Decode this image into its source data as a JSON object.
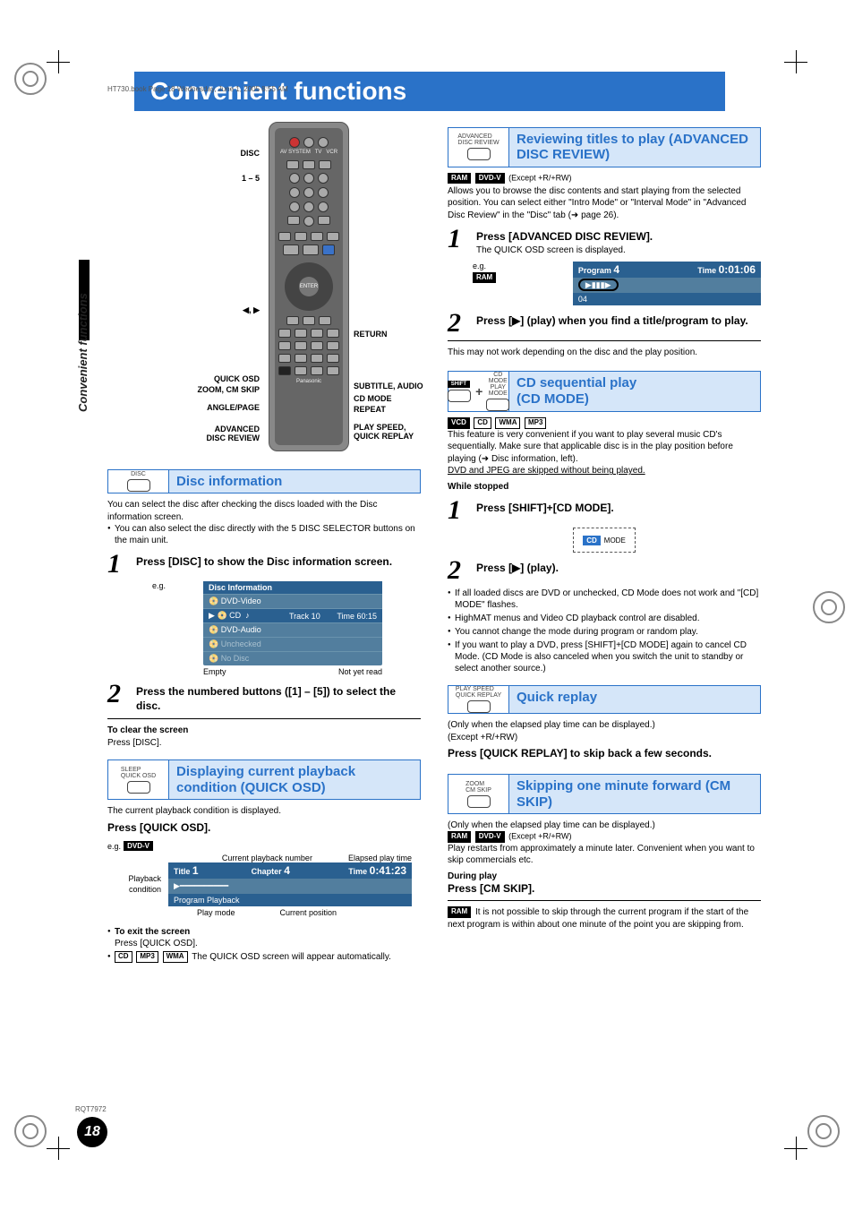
{
  "bookmark": "HT730.book  Page 18  Wednesday, June 1, 2005  8:55 AM",
  "page_title": "Convenient functions",
  "side_label": "Convenient functions",
  "rqt": "RQT7972",
  "page_number": "18",
  "remote_callouts": {
    "disc": "DISC",
    "one_to_five": "1 – 5",
    "nav_arrows": "◀, ▶",
    "quick_osd": "QUICK OSD",
    "zoom_cm": "ZOOM, CM SKIP",
    "angle_page": "ANGLE/PAGE",
    "adv_review": "ADVANCED\nDISC REVIEW",
    "return": "RETURN",
    "subtitle_audio": "SUBTITLE, AUDIO",
    "cd_mode": "CD MODE",
    "repeat": "REPEAT",
    "play_speed": "PLAY SPEED,\nQUICK REPLAY"
  },
  "disc_info": {
    "button_label": "DISC",
    "title": "Disc information",
    "intro1": "You can select the disc after checking the discs loaded with the Disc information screen.",
    "intro2": "You can also select the disc directly with the 5 DISC SELECTOR buttons on the main unit.",
    "step1": "Press [DISC] to show the Disc information screen.",
    "eg": "e.g.",
    "table_header": "Disc Information",
    "rows": [
      {
        "label": "DVD-Video",
        "col2": "",
        "col3": ""
      },
      {
        "label": "CD",
        "col2": "Track 10",
        "col3": "Time 60:15"
      },
      {
        "label": "DVD-Audio",
        "col2": "",
        "col3": ""
      },
      {
        "label": "Unchecked",
        "col2": "",
        "col3": ""
      },
      {
        "label": "No Disc",
        "col2": "",
        "col3": ""
      }
    ],
    "empty_label": "Empty",
    "notread_label": "Not yet read",
    "step2": "Press the numbered buttons ([1] – [5]) to select the disc.",
    "clear_head": "To clear the screen",
    "clear_body": "Press [DISC]."
  },
  "quick_osd": {
    "btn_label": "SLEEP\nQUICK OSD",
    "title": "Displaying current playback condition (QUICK OSD)",
    "intro": "The current playback condition is displayed.",
    "press": "Press [QUICK OSD].",
    "eg": "e.g.",
    "badge": "DVD-V",
    "labels": {
      "cur_num": "Current playback number",
      "elapsed": "Elapsed play time",
      "playback_cond": "Playback\ncondition",
      "play_mode": "Play mode",
      "cur_pos": "Current position"
    },
    "osd": {
      "title_label": "Title",
      "title_val": "1",
      "chapter_label": "Chapter",
      "chapter_val": "4",
      "time_label": "Time",
      "time_val": "0:41:23",
      "program": "Program Playback"
    },
    "exit_head": "To exit the screen",
    "exit_body": "Press [QUICK OSD].",
    "footer_badges": [
      "CD",
      "MP3",
      "WMA"
    ],
    "footer_text": " The QUICK OSD screen will appear automatically."
  },
  "adv_review": {
    "btn_label": "ADVANCED\nDISC REVIEW",
    "title": "Reviewing titles to play (ADVANCED DISC REVIEW)",
    "badges": [
      "RAM",
      "DVD-V"
    ],
    "except": " (Except +R/+RW)",
    "intro": "Allows you to browse the disc contents and start playing from the selected position. You can select either \"Intro Mode\" or \"Interval Mode\" in \"Advanced Disc Review\" in the \"Disc\" tab (➜ page 26).",
    "step1": "Press [ADVANCED DISC REVIEW].",
    "sub1": "The QUICK OSD screen is displayed.",
    "eg": "e.g.",
    "eg_badge": "RAM",
    "osd": {
      "program_label": "Program",
      "program_val": "4",
      "time_label": "Time",
      "time_val": "0:01:06",
      "marker": "04",
      "play_icons": "▶▮▮▮▶"
    },
    "step2": "Press [▶] (play) when you find a title/program to play.",
    "note": "This may not work depending on the disc and the play position."
  },
  "cd_mode": {
    "btn_upper": "SHIFT",
    "btn_label": "CD MODE\nPLAY MODE",
    "title": "CD sequential play\n(CD MODE)",
    "badges": [
      "VCD",
      "CD",
      "WMA",
      "MP3"
    ],
    "intro": "This feature is very convenient if you want to play several music CD's sequentially. Make sure that applicable disc is in the play position before playing (➜ Disc information, left).",
    "skip_note": "DVD and JPEG are skipped without being played.",
    "while_stopped": "While stopped",
    "step1": "Press [SHIFT]+[CD MODE].",
    "cd_badge": "CD",
    "mode_text": "MODE",
    "step2": "Press [▶] (play).",
    "bullets": [
      "If all loaded discs are DVD or unchecked, CD Mode does not work and \"[CD] MODE\" flashes.",
      "HighMAT menus and Video CD playback control are disabled.",
      "You cannot change the mode during program or random play.",
      "If you want to play a DVD, press [SHIFT]+[CD MODE] again to cancel CD Mode. (CD Mode is also canceled when you switch the unit to standby or select another source.)"
    ]
  },
  "quick_replay": {
    "btn_label": "PLAY SPEED\nQUICK REPLAY",
    "title": "Quick replay",
    "line1": "(Only when the elapsed play time can be displayed.)",
    "line2": "(Except +R/+RW)",
    "press": "Press [QUICK REPLAY] to skip back a few seconds."
  },
  "cm_skip": {
    "btn_label": "ZOOM\nCM SKIP",
    "title": "Skipping one minute forward (CM SKIP)",
    "line1": "(Only when the elapsed play time can be displayed.)",
    "badges": [
      "RAM",
      "DVD-V"
    ],
    "except": " (Except +R/+RW)",
    "intro": "Play restarts from approximately a minute later. Convenient when you want to skip commercials etc.",
    "during": "During play",
    "press": "Press [CM SKIP].",
    "note_badge": "RAM",
    "note": " It is not possible to skip through the current program if the start of the next program is within about one minute of the point you are skipping from."
  }
}
